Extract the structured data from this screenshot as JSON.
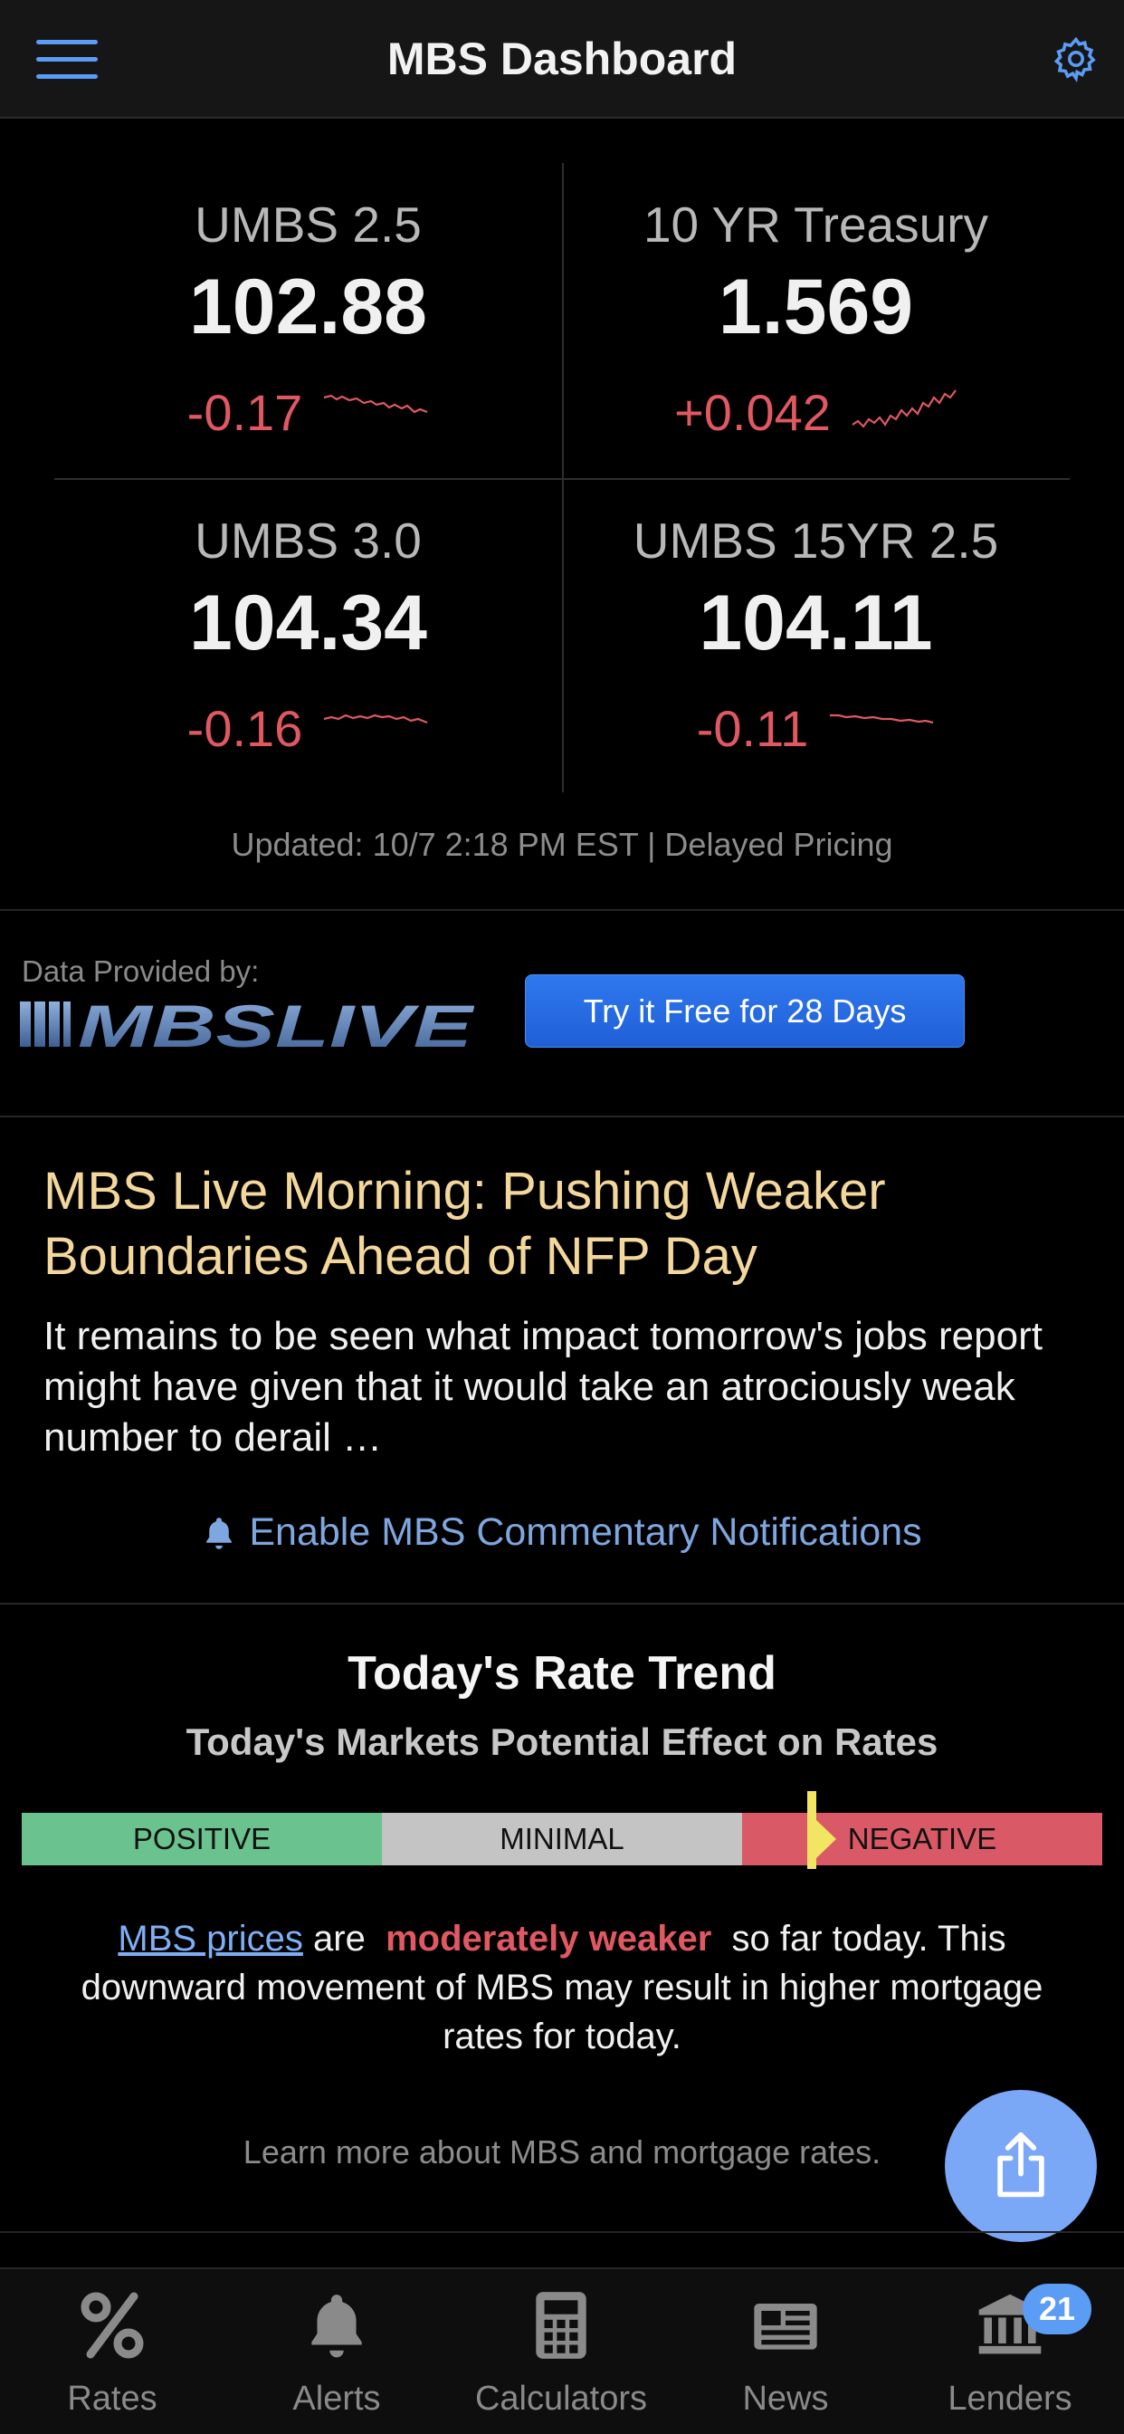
{
  "header": {
    "title": "MBS Dashboard"
  },
  "quotes": [
    {
      "label": "UMBS 2.5",
      "value": "102.88",
      "change": "-0.17"
    },
    {
      "label": "10 YR Treasury",
      "value": "1.569",
      "change": "+0.042"
    },
    {
      "label": "UMBS 3.0",
      "value": "104.34",
      "change": "-0.16"
    },
    {
      "label": "UMBS 15YR 2.5",
      "value": "104.11",
      "change": "-0.11"
    }
  ],
  "updated": "Updated: 10/7 2:18 PM EST | Delayed Pricing",
  "provider": {
    "label": "Data Provided by:",
    "logo_text": "MBSLIVE",
    "cta": "Try it Free for 28 Days"
  },
  "article": {
    "title": "MBS Live Morning: Pushing Weaker Boundaries Ahead of NFP Day",
    "body": "It remains to be seen what impact tomorrow's jobs report might have given that it would take an atrociously weak number to derail …",
    "notify": "Enable MBS Commentary Notifications"
  },
  "trend": {
    "title": "Today's Rate Trend",
    "subtitle": "Today's Markets Potential Effect on Rates",
    "segments": [
      "POSITIVE",
      "MINIMAL",
      "NEGATIVE"
    ],
    "marker_position": 0.731,
    "summary_link": "MBS prices",
    "summary_are": "are",
    "summary_strength": "moderately weaker",
    "summary_rest": "so far today. This downward movement of MBS may result in higher mortgage rates for today.",
    "learn_more": "Learn more about MBS and mortgage rates."
  },
  "colors": {
    "accent": "#5b9cf5",
    "negative": "#e05862",
    "headline": "#f3d79b",
    "positive_seg": "#6ac28e",
    "neutral_seg": "#c4c4c4",
    "negative_seg": "#d95a66",
    "marker": "#f2e564"
  },
  "tabs": [
    {
      "label": "Rates",
      "icon": "percent-icon"
    },
    {
      "label": "Alerts",
      "icon": "bell-icon"
    },
    {
      "label": "Calculators",
      "icon": "calculator-icon"
    },
    {
      "label": "News",
      "icon": "newspaper-icon"
    },
    {
      "label": "Lenders",
      "icon": "bank-icon",
      "badge": "21"
    }
  ]
}
